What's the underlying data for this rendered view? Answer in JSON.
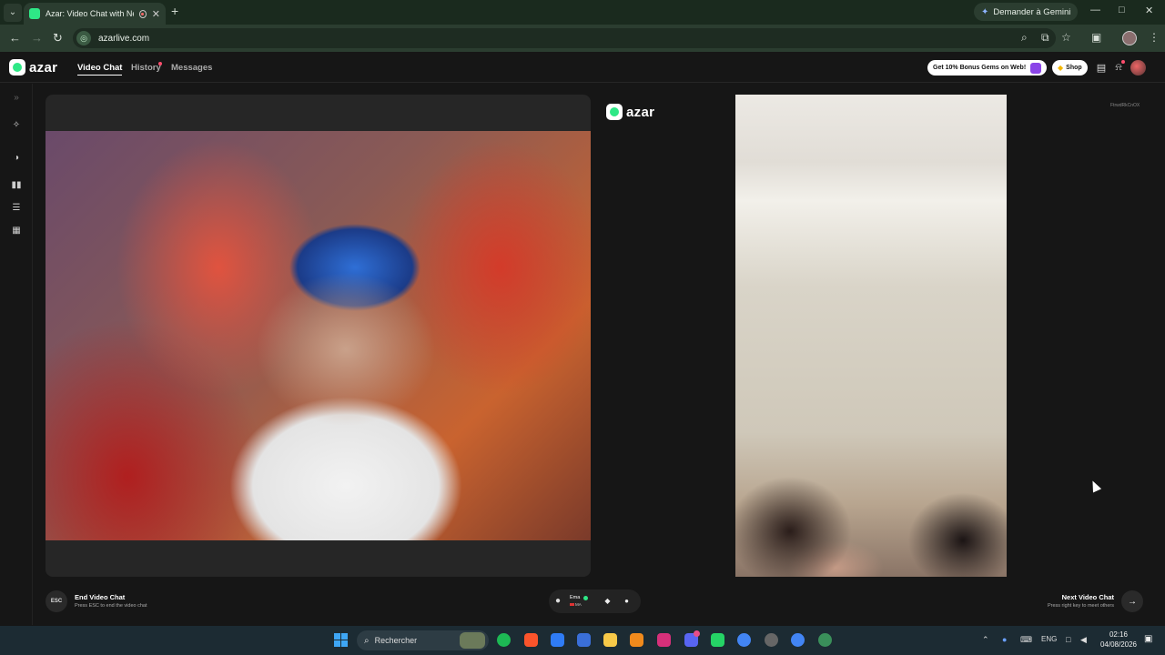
{
  "browser": {
    "tab_title": "Azar: Video Chat with New",
    "gemini_label": "Demander à Gemini",
    "url": "azarlive.com"
  },
  "header": {
    "logo_text": "azar",
    "nav": [
      {
        "label": "Video Chat",
        "active": true
      },
      {
        "label": "History",
        "active": false
      },
      {
        "label": "Messages",
        "active": false
      }
    ],
    "gems_promo": "Get 10% Bonus Gems on Web!",
    "shop_label": "Shop"
  },
  "stage": {
    "remote_brand": "azar",
    "remote_id": "FtrwdRkCnOX"
  },
  "controls": {
    "end_key": "ESC",
    "end_title": "End Video Chat",
    "end_sub": "Press ESC to end the video chat",
    "partner_name": "Ema",
    "partner_country": "MA",
    "next_title": "Next Video Chat",
    "next_sub": "Press right key to meet others"
  },
  "taskbar": {
    "search_placeholder": "Rechercher",
    "language": "ENG",
    "time": "02:16",
    "date": "04/08/2026"
  },
  "colors": {
    "accent": "#2ee886",
    "browser_frame": "#2b3d30",
    "background": "#161616"
  }
}
